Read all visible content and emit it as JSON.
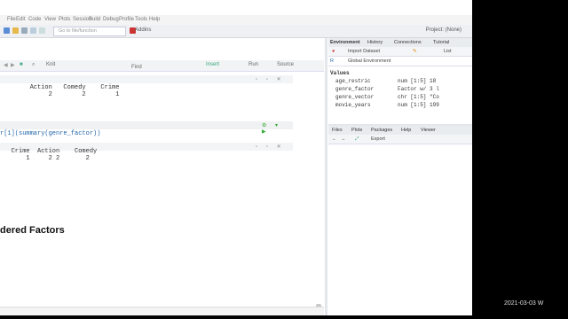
{
  "menu": [
    "File",
    "Edit",
    "Code",
    "View",
    "Plots",
    "Session",
    "Build",
    "Debug",
    "Profile",
    "Tools",
    "Help"
  ],
  "toolbar": {
    "goto_placeholder": "Go to file/function",
    "addins": "Addins",
    "project": "Project: (None)"
  },
  "editor_toolbar": {
    "find": "Find",
    "run": "Run",
    "source": "Source",
    "insert": "Insert",
    "knit": "Knit"
  },
  "chunk1_output": "        Action   Comedy    Crime\n             2        2        1",
  "chunk2_code": "r[1](summary(genre_factor))",
  "chunk2_output": "   Crime  Action    Comedy\n       1     2 2       2",
  "heading": "dered Factors",
  "env_tabs": [
    "Environment",
    "History",
    "Connections",
    "Tutorial"
  ],
  "env_subbar": {
    "import": "Import Dataset",
    "list": "List"
  },
  "env_scope": "Global Environment",
  "values_header": "Values",
  "variables": [
    {
      "name": "age_restric",
      "value": "num [1:5] 18"
    },
    {
      "name": "genre_factor",
      "value": "Factor w/ 3 l"
    },
    {
      "name": "genre_vector",
      "value": "chr [1:5] \"Co"
    },
    {
      "name": "movie_years",
      "value": "num [1:5] 199"
    }
  ],
  "files_tabs": [
    "Files",
    "Plots",
    "Packages",
    "Help",
    "Viewer"
  ],
  "files_sub": {
    "export": "Export"
  },
  "timestamp": "2021-03-03 W"
}
